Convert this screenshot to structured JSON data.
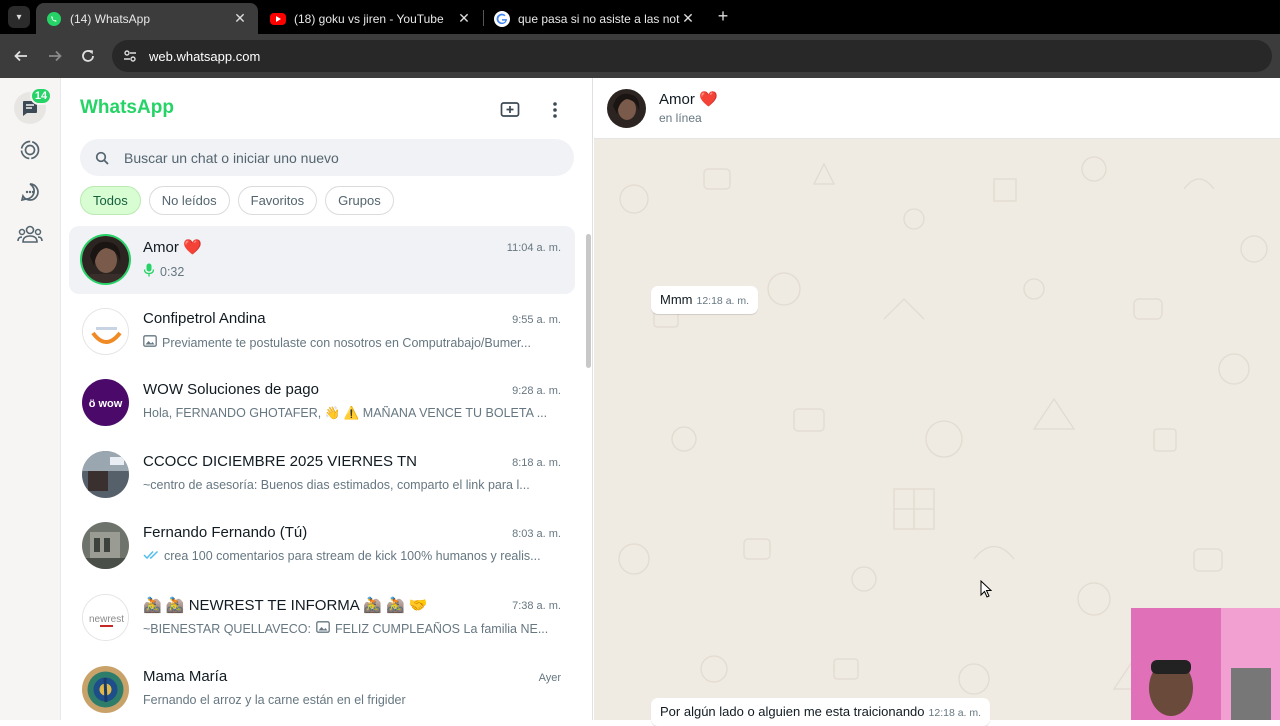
{
  "browser": {
    "tabs": [
      {
        "title": "(14) WhatsApp",
        "favicon": "whatsapp-favicon",
        "active": true
      },
      {
        "title": "(18) goku vs jiren - YouTube",
        "favicon": "youtube-favicon",
        "active": false
      },
      {
        "title": "que pasa si no asiste a las notifi",
        "favicon": "google-favicon",
        "active": false
      }
    ],
    "url": "web.whatsapp.com",
    "close_glyph": "✕",
    "new_tab_glyph": "+"
  },
  "rail": {
    "unread_badge": "14"
  },
  "sidebar": {
    "brand": "WhatsApp",
    "search_placeholder": "Buscar un chat o iniciar uno nuevo",
    "filters": [
      "Todos",
      "No leídos",
      "Favoritos",
      "Grupos"
    ],
    "chats": [
      {
        "name": "Amor ❤️",
        "time": "11:04 a. m.",
        "message": "0:32",
        "icon": "mic-icon",
        "selected": true
      },
      {
        "name": "Confipetrol Andina",
        "time": "9:55 a. m.",
        "message": "Previamente te postulaste con nosotros en Computrabajo/Bumer...",
        "icon": "image-icon"
      },
      {
        "name": "WOW Soluciones de pago",
        "time": "9:28 a. m.",
        "message": "Hola, FERNANDO GHOTAFER, 👋 ⚠️ MAÑANA VENCE TU BOLETA ..."
      },
      {
        "name": "CCOCC DICIEMBRE 2025 VIERNES TN",
        "time": "8:18 a. m.",
        "message": "~centro de asesoría: Buenos dias estimados, comparto el link para l..."
      },
      {
        "name": "Fernando Fernando (Tú)",
        "time": "8:03 a. m.",
        "message": "crea 100 comentarios para stream de kick 100% humanos y realis...",
        "icon": "double-check-icon"
      },
      {
        "name": "🚵 🚵 NEWREST TE INFORMA 🚵 🚵 🤝",
        "time": "7:38 a. m.",
        "message_prefix": "~BIENESTAR QUELLAVECO:",
        "message": "FELIZ CUMPLEAÑOS La familia NE...",
        "icon": "image-icon"
      },
      {
        "name": "Mama María",
        "time": "Ayer",
        "message": "Fernando el arroz y la carne están en el frigider"
      }
    ]
  },
  "conversation": {
    "contact_name": "Amor ❤️",
    "status": "en línea",
    "messages": [
      {
        "text": "Mmm",
        "time": "12:18 a. m."
      },
      {
        "text": "Por algún lado o alguien me esta traicionando",
        "time": "12:18 a. m."
      }
    ]
  },
  "colors": {
    "accent": "#25d366",
    "chat_bg": "#efeae2",
    "chip_active_bg": "#d9fdd3"
  }
}
